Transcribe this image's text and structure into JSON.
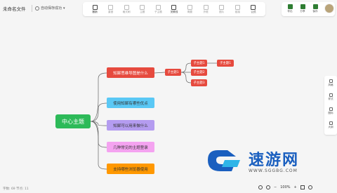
{
  "header": {
    "filename": "未命名文件",
    "autosave": "自动保存成功",
    "autosave_chevron": "▾"
  },
  "toolbar": [
    {
      "label": "撤销",
      "icon": "undo-icon",
      "active": true
    },
    {
      "label": "重做",
      "icon": "redo-icon",
      "active": false
    },
    {
      "label": "格式刷",
      "icon": "format-painter-icon",
      "active": false
    },
    {
      "label": "主题",
      "icon": "topic-icon",
      "active": false
    },
    {
      "label": "子主题",
      "icon": "subtopic-icon",
      "active": false
    },
    {
      "label": "关联线",
      "icon": "relation-line-icon",
      "active": true
    },
    {
      "label": "概要",
      "icon": "summary-icon",
      "active": false
    },
    {
      "label": "外框",
      "icon": "frame-icon",
      "active": false
    },
    {
      "label": "图片",
      "icon": "image-icon",
      "active": false
    },
    {
      "label": "链接",
      "icon": "link-icon",
      "active": false
    },
    {
      "label": "公式",
      "icon": "formula-icon",
      "active": true
    }
  ],
  "right_tools": [
    {
      "label": "导出",
      "icon": "export-icon"
    },
    {
      "label": "分享",
      "icon": "share-icon"
    },
    {
      "label": "保存",
      "icon": "save-icon"
    }
  ],
  "side_panel": [
    {
      "label": "风格",
      "icon": "style-icon"
    },
    {
      "label": "样式",
      "icon": "theme-icon"
    },
    {
      "label": "图标",
      "icon": "icon-library-icon"
    },
    {
      "label": "大纲",
      "icon": "outline-icon"
    }
  ],
  "mindmap": {
    "central": "中心主题",
    "branches": [
      {
        "label": "知犀思维导图是什么",
        "color": "#e64a3e",
        "text_color": "#ffffff"
      },
      {
        "label": "使用知犀有哪些优点",
        "color": "#5ac8f5",
        "text_color": "#333333"
      },
      {
        "label": "知犀可以用来做什么",
        "color": "#b49cf0",
        "text_color": "#333333"
      },
      {
        "label": "几种常见的主题登录",
        "color": "#f4a3f0",
        "text_color": "#333333"
      },
      {
        "label": "支持哪些浏览器使用",
        "color": "#ff9800",
        "text_color": "#333333"
      }
    ],
    "subtopic": "子主题1",
    "leaves": [
      "子主题1",
      "子主题2",
      "子主题3"
    ],
    "leaf_of_leaf": "子主题1"
  },
  "watermark": {
    "text": "速游网",
    "url": "WWW.SGGBG.COM"
  },
  "footer": {
    "count": "字数: 69   节点: 11",
    "zoom": "100%",
    "zoom_minus": "−",
    "zoom_plus": "+"
  },
  "colors": {
    "central": "#2dba59",
    "link": "#666666",
    "accent": "#2e7d32"
  }
}
